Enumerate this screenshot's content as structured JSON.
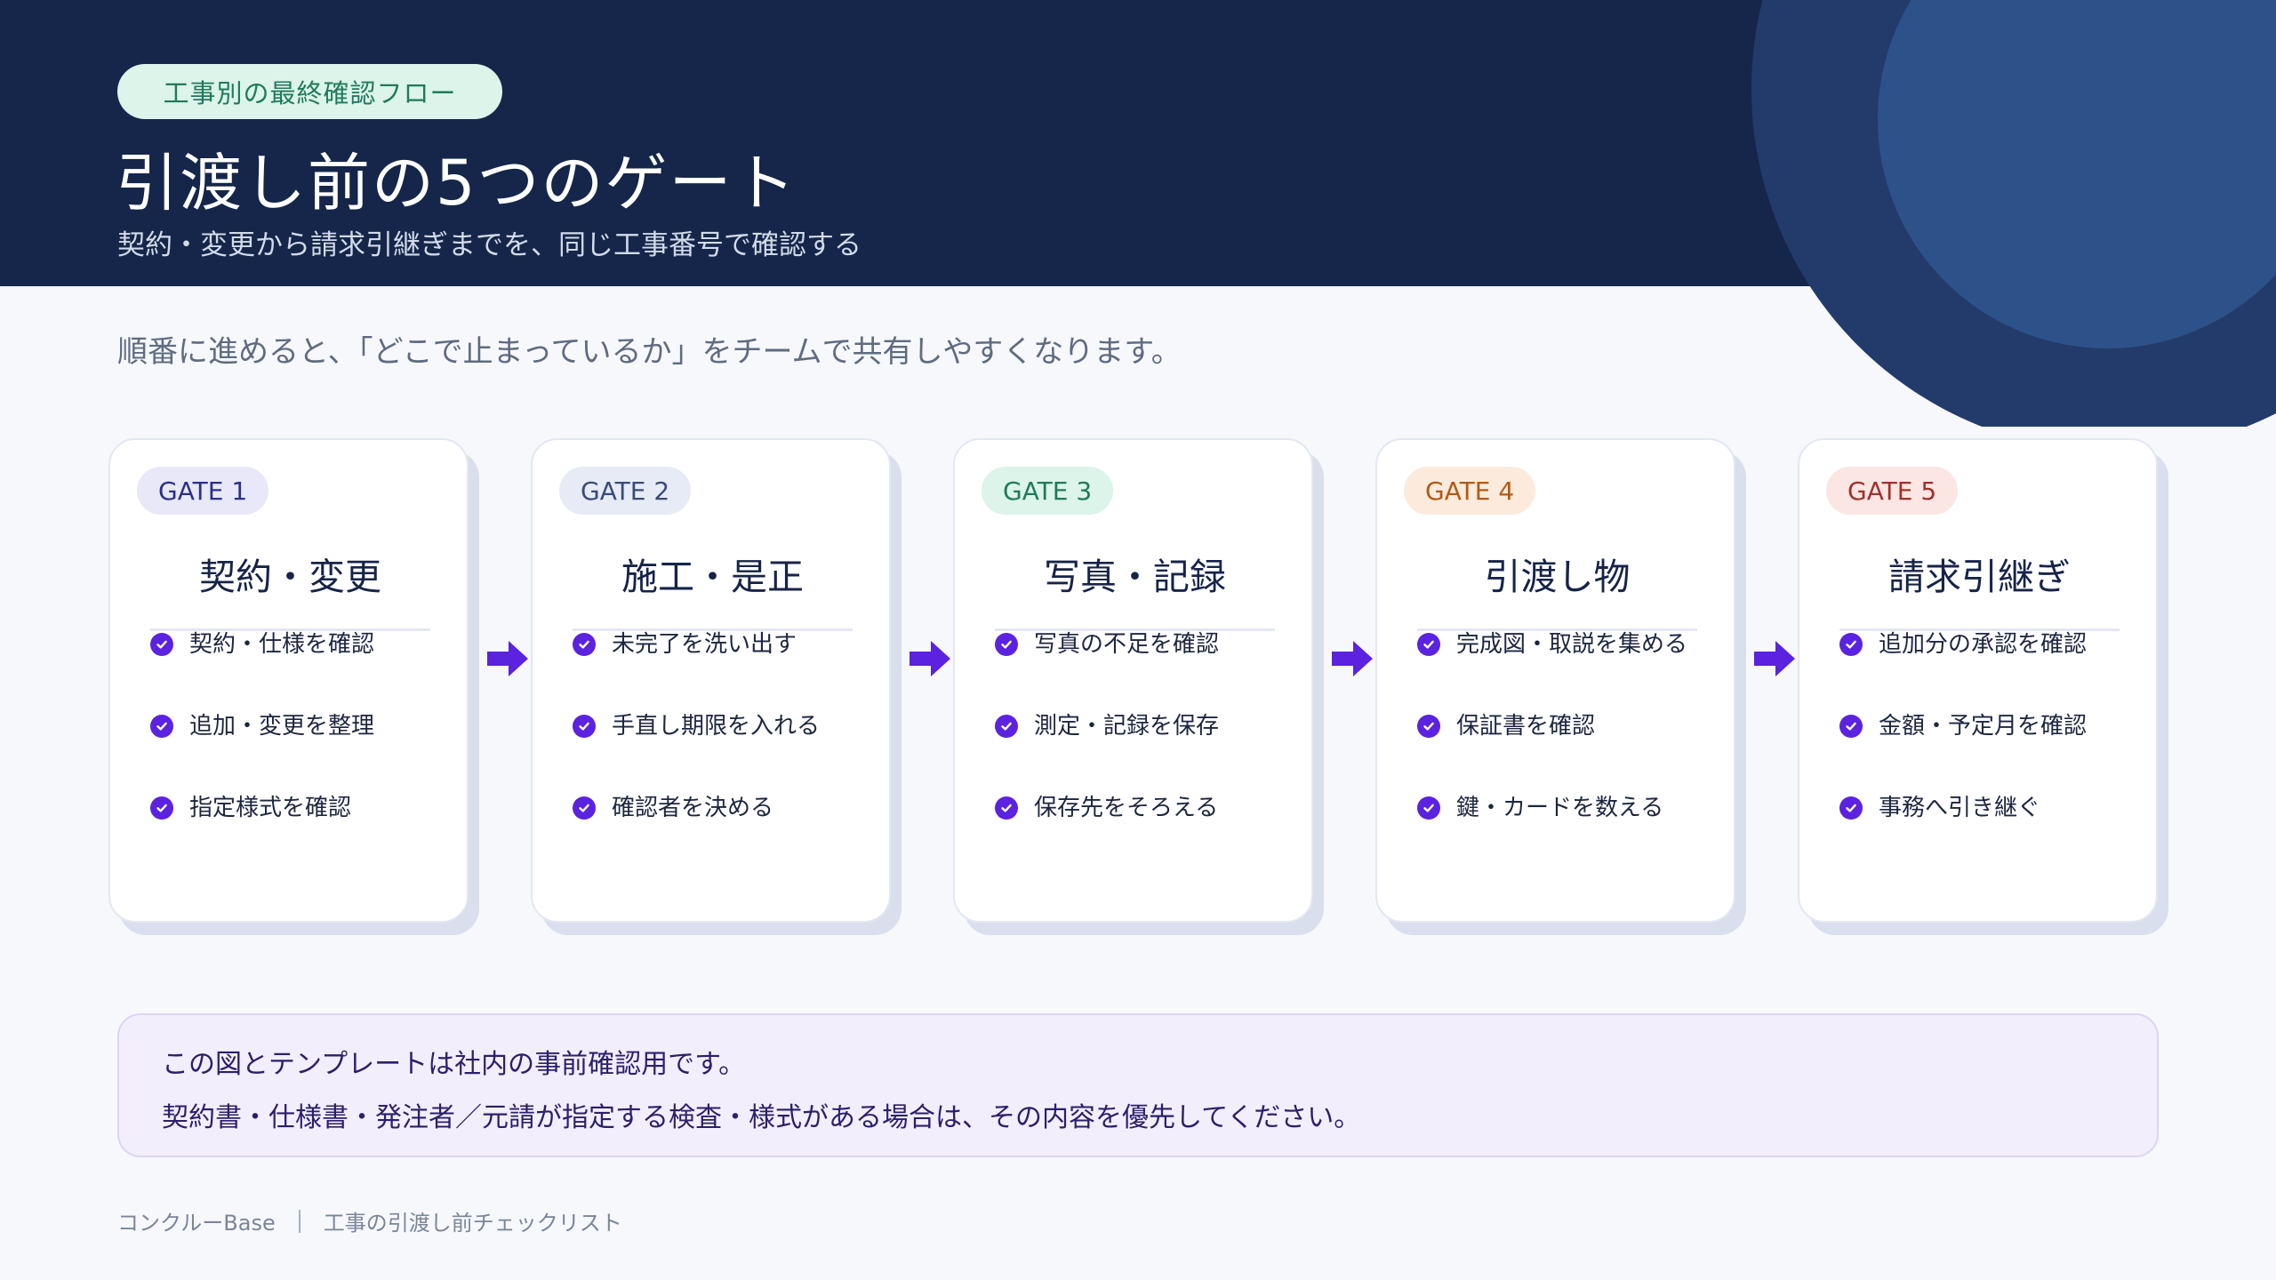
{
  "header": {
    "eyebrow": "工事別の最終確認フロー",
    "title": "引渡し前の5つのゲート",
    "subtitle": "契約・変更から請求引継ぎまでを、同じ工事番号で確認する"
  },
  "lead": "順番に進めると、「どこで止まっているか」をチームで共有しやすくなります。",
  "gates": [
    {
      "badge": "GATE 1",
      "badge_bg": "#e8e8f8",
      "badge_color": "#2c2f8c",
      "name": "契約・変更",
      "items": [
        "契約・仕様を確認",
        "追加・変更を整理",
        "指定様式を確認"
      ]
    },
    {
      "badge": "GATE 2",
      "badge_bg": "#e6ebf5",
      "badge_color": "#3a4a7a",
      "name": "施工・是正",
      "items": [
        "未完了を洗い出す",
        "手直し期限を入れる",
        "確認者を決める"
      ]
    },
    {
      "badge": "GATE 3",
      "badge_bg": "#dcf4ea",
      "badge_color": "#1f7a5c",
      "name": "写真・記録",
      "items": [
        "写真の不足を確認",
        "測定・記録を保存",
        "保存先をそろえる"
      ]
    },
    {
      "badge": "GATE 4",
      "badge_bg": "#fcebdc",
      "badge_color": "#b25a14",
      "name": "引渡し物",
      "items": [
        "完成図・取説を集める",
        "保証書を確認",
        "鍵・カードを数える"
      ]
    },
    {
      "badge": "GATE 5",
      "badge_bg": "#fbe6e4",
      "badge_color": "#a3302a",
      "name": "請求引継ぎ",
      "items": [
        "追加分の承認を確認",
        "金額・予定月を確認",
        "事務へ引き継ぐ"
      ]
    }
  ],
  "arrow_icon": "arrow-right-icon",
  "check_icon": "check-circle-icon",
  "accent_color": "#5b22e0",
  "note": {
    "line1": "この図とテンプレートは社内の事前確認用です。",
    "line2": "契約書・仕様書・発注者／元請が指定する検査・様式がある場合は、その内容を優先してください。"
  },
  "footer": {
    "brand": "コンクルーBase",
    "doc": "工事の引渡し前チェックリスト"
  }
}
